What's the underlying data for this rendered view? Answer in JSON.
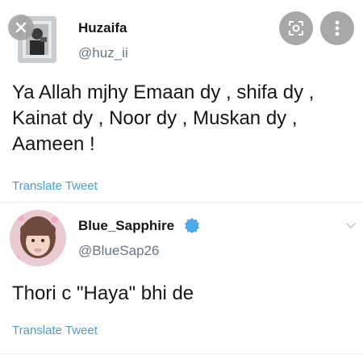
{
  "tweets": [
    {
      "display_name": "Huzaifa",
      "handle": "@huz_ii",
      "text": "Ya Allah mjhy Emaan dy , shifa dy ,\nKainat dy , Noor dy , Muskan dy ,\nAameen !",
      "translate_label": "Translate Tweet",
      "verified": false
    },
    {
      "display_name": "Blue_Sapphire",
      "handle": "@BlueSap26",
      "text": "Thori c \"Haya\" bhi de",
      "translate_label": "Translate Tweet",
      "verified": true
    }
  ],
  "overlay": {
    "close_icon": "close-icon",
    "lens_icon": "lens-icon",
    "more_icon": "more-vertical-icon"
  },
  "colors": {
    "link": "#4a9fc9",
    "verified": "#4ea9e8",
    "overlay_button": "#a8a8a8"
  }
}
